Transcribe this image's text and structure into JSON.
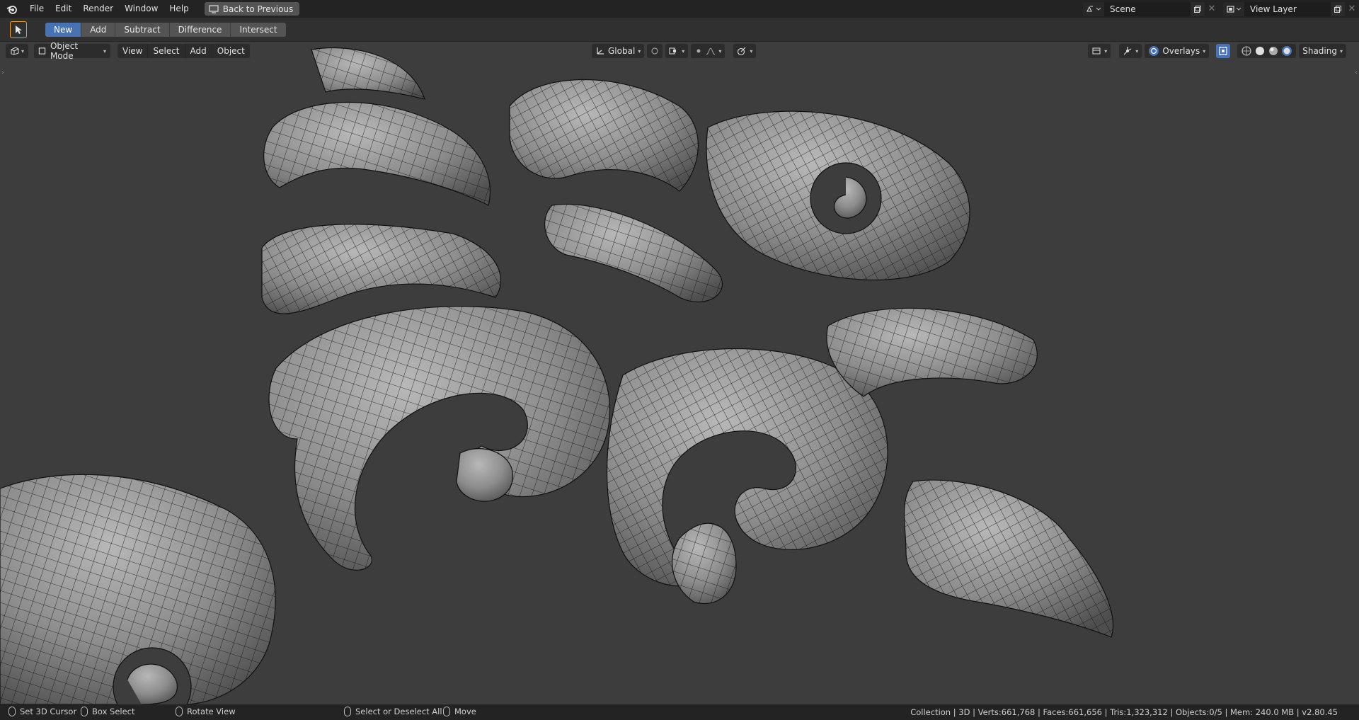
{
  "topbar": {
    "menus": [
      "File",
      "Edit",
      "Render",
      "Window",
      "Help"
    ],
    "back_label": "Back to Previous",
    "scene_name": "Scene",
    "view_layer": "View Layer"
  },
  "toolheader": {
    "modes": [
      "New",
      "Add",
      "Subtract",
      "Difference",
      "Intersect"
    ],
    "active_mode": "New"
  },
  "viewport": {
    "object_mode": "Object Mode",
    "menus": [
      "View",
      "Select",
      "Add",
      "Object"
    ],
    "orientation": "Global",
    "overlays_label": "Overlays",
    "shading_label": "Shading"
  },
  "statusbar": {
    "hints": [
      "Set 3D Cursor",
      "Box Select",
      "Rotate View",
      "Select or Deselect All",
      "Move"
    ],
    "stats": "Collection | 3D | Verts:661,768 | Faces:661,656 | Tris:1,323,312 | Objects:0/5 | Mem: 240.0 MB | v2.80.45"
  },
  "colors": {
    "accent_blue": "#4772b3",
    "active_tool_orange": "#f29d27",
    "viewport_bg": "#3d3d3d",
    "mesh_fill": "#8a8a8a",
    "wire": "#111111"
  }
}
